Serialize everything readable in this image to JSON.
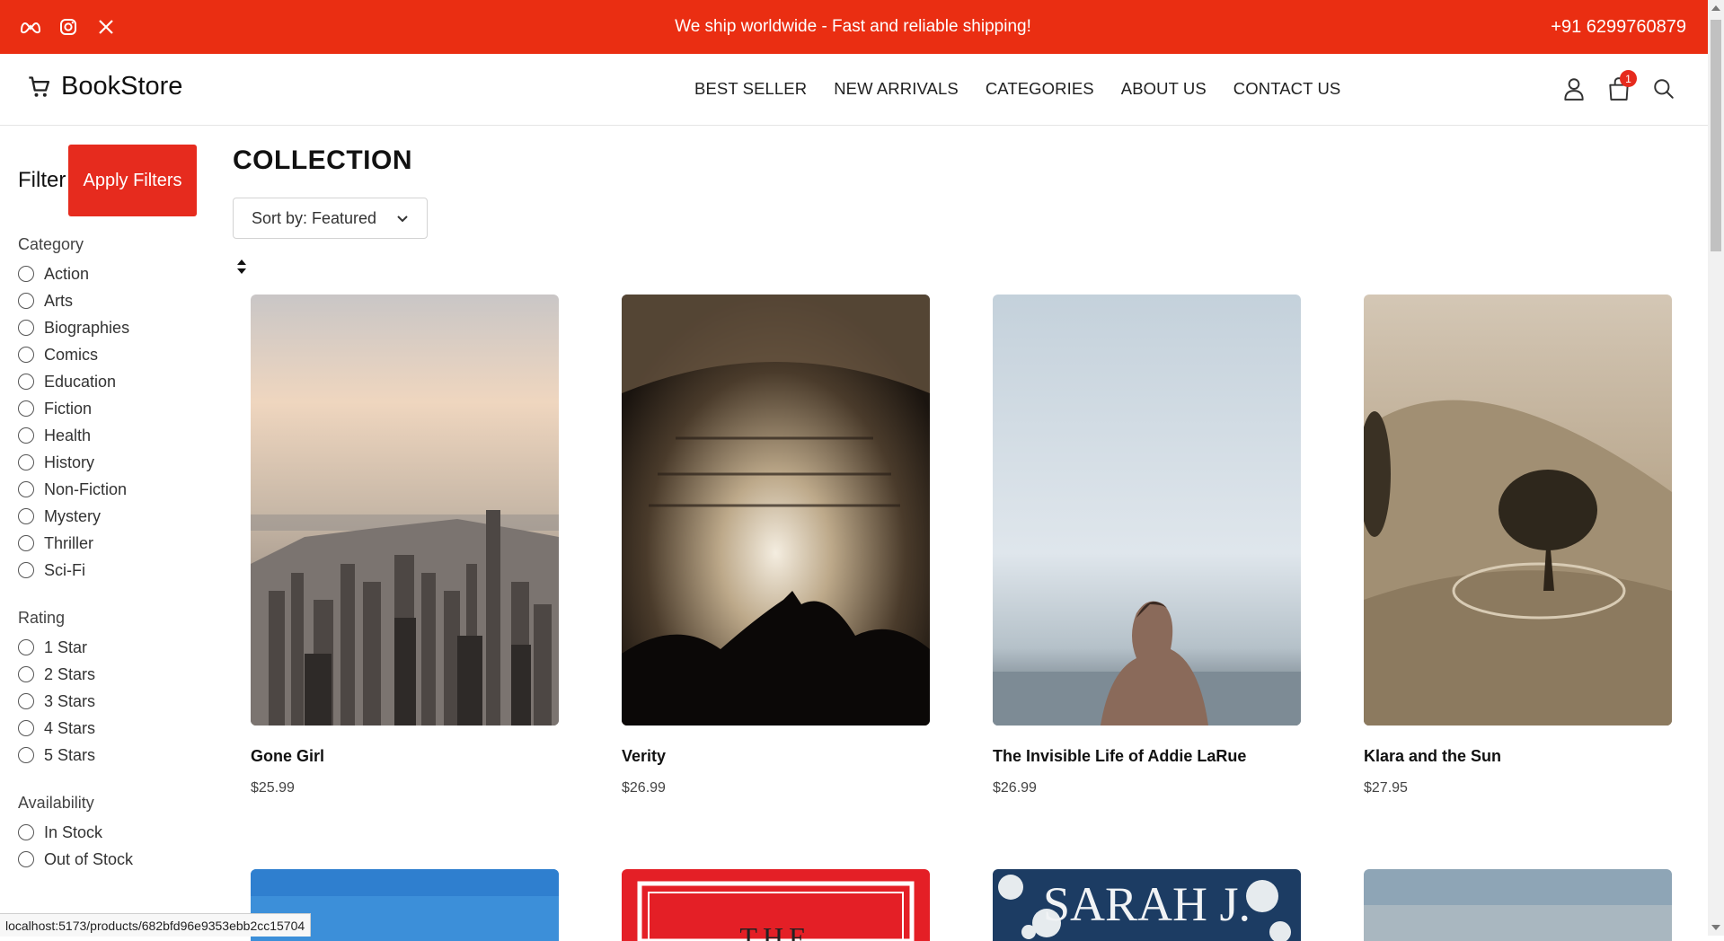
{
  "topbar": {
    "message": "We ship worldwide - Fast and reliable shipping!",
    "phone": "+91 6299760879",
    "socials": [
      "meta-icon",
      "instagram-icon",
      "x-icon"
    ],
    "bg_color": "#ea2e12"
  },
  "header": {
    "brand": "BookStore",
    "nav": [
      "BEST SELLER",
      "NEW ARRIVALS",
      "CATEGORIES",
      "ABOUT US",
      "CONTACT US"
    ],
    "cart_count": "1",
    "icons": [
      "user-icon",
      "shopping-bag-icon",
      "search-icon"
    ]
  },
  "sidebar": {
    "title": "Filter",
    "apply_label": "Apply Filters",
    "category_title": "Category",
    "categories": [
      "Action",
      "Arts",
      "Biographies",
      "Comics",
      "Education",
      "Fiction",
      "Health",
      "History",
      "Non-Fiction",
      "Mystery",
      "Thriller",
      "Sci-Fi"
    ],
    "rating_title": "Rating",
    "ratings": [
      "1 Star",
      "2 Stars",
      "3 Stars",
      "4 Stars",
      "5 Stars"
    ],
    "availability_title": "Availability",
    "availability": [
      "In Stock",
      "Out of Stock"
    ]
  },
  "main": {
    "title": "COLLECTION",
    "sort_label": "Sort by: Featured",
    "products": [
      {
        "title": "Gone Girl",
        "price": "$25.99"
      },
      {
        "title": "Verity",
        "price": "$26.99"
      },
      {
        "title": "The Invisible Life of Addie LaRue",
        "price": "$26.99"
      },
      {
        "title": "Klara and the Sun",
        "price": "$27.95"
      }
    ],
    "second_row_texts": [
      "THE",
      "SARAH J."
    ]
  },
  "statusbar": {
    "url": "localhost:5173/products/682bfd96e9353ebb2cc15704"
  },
  "colors": {
    "accent": "#e62b1e"
  }
}
